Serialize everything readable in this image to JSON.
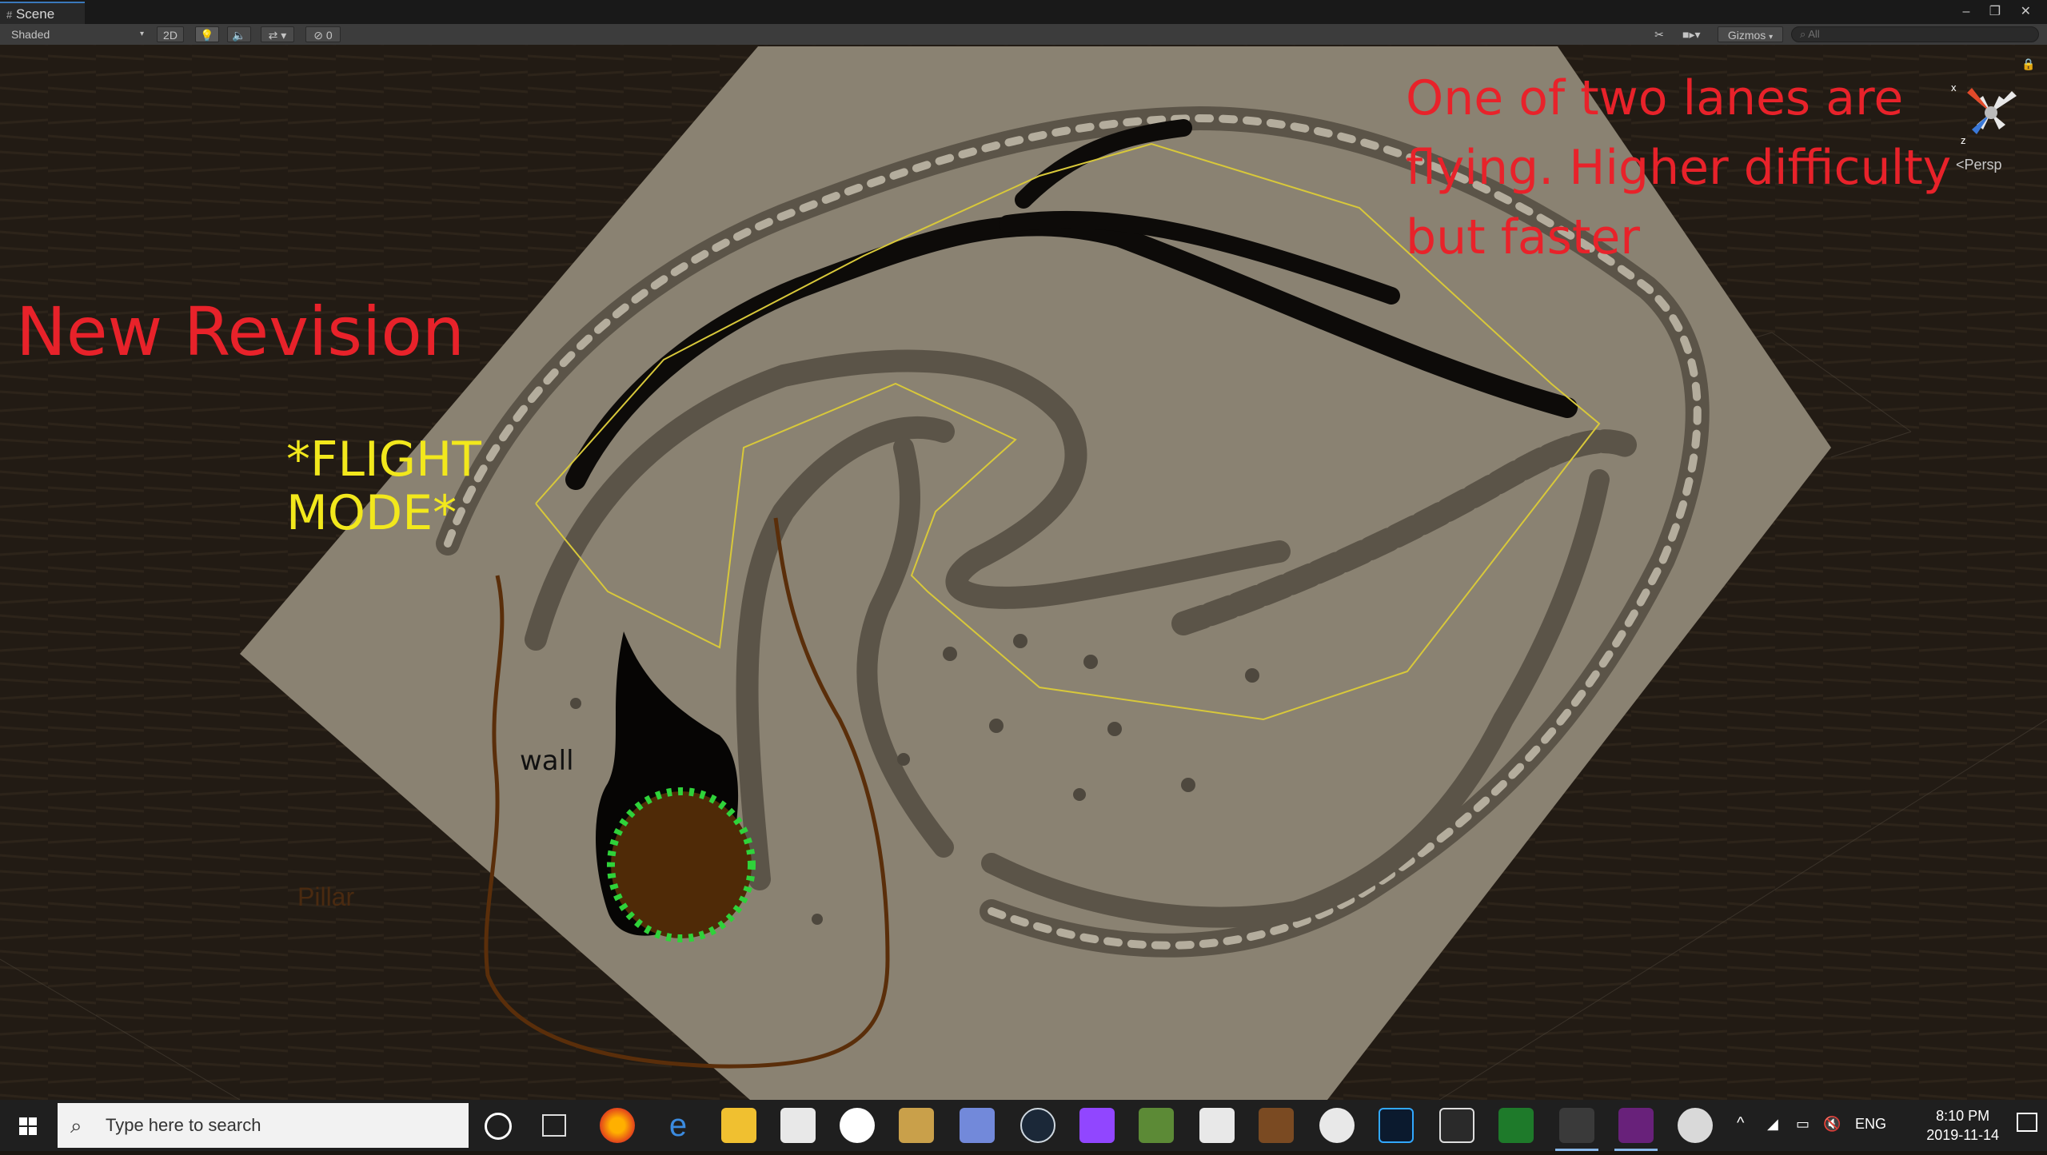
{
  "window": {
    "tab_label": "Scene",
    "controls": "– ❐ ✕"
  },
  "toolbar": {
    "shading_mode": "Shaded",
    "mode_2d": "2D",
    "hidden_count": "0",
    "gizmos_label": "Gizmos",
    "search_placeholder": "All"
  },
  "viewport": {
    "persp_label": "Persp",
    "gizmo_axes": {
      "x": "x",
      "z": "z"
    },
    "scene_label_pillar": "Pillar",
    "annotations": {
      "new_revision": "New Revision",
      "flight_mode_line1": "*FLIGHT",
      "flight_mode_line2": "MODE*",
      "lanes_line1": "One of two lanes are",
      "lanes_line2": "flying. Higher difficulty",
      "lanes_line3": "but faster",
      "wall": "wall"
    },
    "colors": {
      "annotation_red": "#e8222a",
      "annotation_yellow": "#f2e81c",
      "plane": "#8a8272",
      "brown_path": "#5a2e0a"
    }
  },
  "taskbar": {
    "search_placeholder": "Type here to search",
    "language": "ENG",
    "time": "8:10 PM",
    "date": "2019-11-14",
    "apps": [
      "task-view",
      "firefox",
      "edge",
      "file-explorer",
      "store",
      "github",
      "league",
      "discord",
      "steam",
      "twitch",
      "minecraft",
      "mail",
      "terraria",
      "xbox",
      "photoshop",
      "epic-games",
      "finale",
      "unity",
      "visual-studio",
      "paint"
    ]
  }
}
